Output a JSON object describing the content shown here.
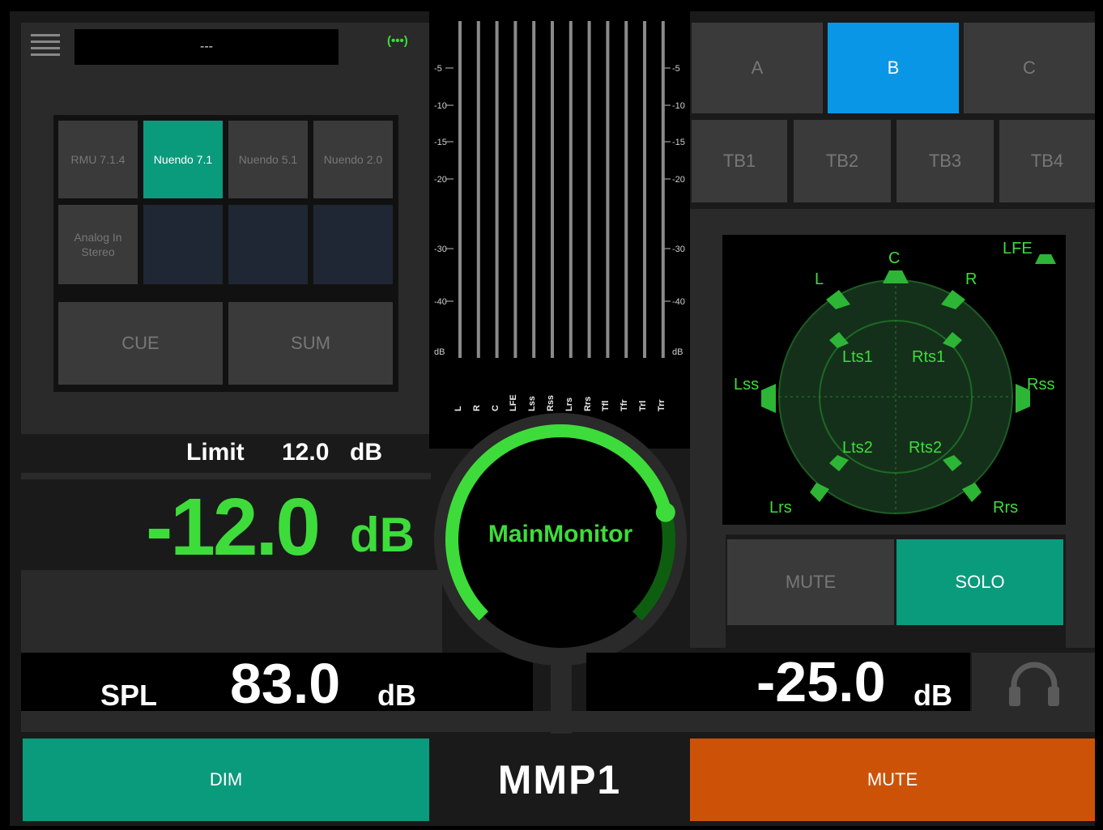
{
  "header": {
    "preset_name": "---"
  },
  "sources": [
    {
      "label": "RMU 7.1.4",
      "active": false
    },
    {
      "label": "Nuendo 7.1",
      "active": true
    },
    {
      "label": "Nuendo 5.1",
      "active": false
    },
    {
      "label": "Nuendo 2.0",
      "active": false
    },
    {
      "label": "Analog In Stereo",
      "active": false
    }
  ],
  "source_actions": {
    "cue": "CUE",
    "sum": "SUM"
  },
  "limit": {
    "label": "Limit",
    "value": "12.0",
    "unit": "dB"
  },
  "level": {
    "value": "-12.0",
    "unit": "dB"
  },
  "spl": {
    "label": "SPL",
    "value": "83.0",
    "unit": "dB"
  },
  "meter": {
    "ticks": [
      "-5",
      "-10",
      "-15",
      "-20",
      "-30",
      "-40",
      "dB"
    ],
    "channels": [
      "L",
      "R",
      "C",
      "LFE",
      "Lss",
      "Rss",
      "Lrs",
      "Rrs",
      "Tfl",
      "Tfr",
      "Trl",
      "Trr"
    ]
  },
  "knob": {
    "label": "MainMonitor",
    "fraction": 0.78
  },
  "sets": [
    {
      "label": "A",
      "active": false
    },
    {
      "label": "B",
      "active": true
    },
    {
      "label": "C",
      "active": false
    }
  ],
  "talkback": [
    "TB1",
    "TB2",
    "TB3",
    "TB4"
  ],
  "speakers": [
    "LFE",
    "C",
    "L",
    "R",
    "Lts1",
    "Rts1",
    "Lss",
    "Rss",
    "Lts2",
    "Rts2",
    "Lrs",
    "Rrs"
  ],
  "speaker_actions": {
    "mute": "MUTE",
    "solo": "SOLO"
  },
  "phones": {
    "value": "-25.0",
    "unit": "dB"
  },
  "footer": {
    "dim": "DIM",
    "brand": "MMP1",
    "mute": "MUTE"
  },
  "colors": {
    "accent_green": "#3ddc3a",
    "teal": "#0a9a7c",
    "blue": "#0a96e6",
    "orange": "#cc5208"
  }
}
